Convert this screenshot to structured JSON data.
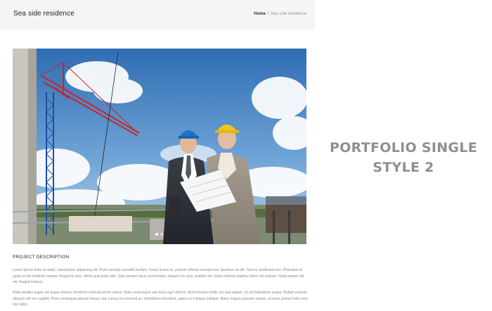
{
  "header": {
    "title": "Sea side residence",
    "breadcrumb": {
      "home": "Home",
      "separator": "/",
      "current": "Sea side residence"
    }
  },
  "hero": {
    "slide_count": 2,
    "active_slide": 1
  },
  "project": {
    "heading": "PROJECT DESCRIPTION",
    "paragraph_1": "Lorem ipsum dolor sit amet, consectetur adipiscing elit. Proin suscipit convallis facilisis. Fusce lectus ex, pretium efficitur suscipit sed, faucibus vel elit. Sed eu vestibulum leo. Phasellus at quam id elit hendrerit semper feugiat id nunc. Morbi quis justo velit. Duis semper lacus scelerisque, aliquam leo quis, porttitor leo. Etiam lobortis dapibus libero vel pretium. Nulla tempor elit nec feugiat tempus.",
    "paragraph_2": "Nulla facilisis augue vel augue viverra, hendrerit vehicula lorem rutrum. Nunc scelerisque sed risus eget ultrices. Morbi lacinia mollis orci sed aliquet. Ut sed bibendum augue. Nullam pretium aliquam elit non sagittis. Proin consequat aliquet massa, non cursus mi euismod ac. Vestibulum hendrerit, sapien in tristique tristique, libero magna posuere massa, sit amet pretium felis eros non dolor."
  },
  "panel": {
    "line_1": "PORTFOLIO SINGLE",
    "line_2": "STYLE 2"
  },
  "colors": {
    "title_bar": "#f5f5f5",
    "panel_text": "#8f8f8f",
    "body_text": "#888888"
  }
}
